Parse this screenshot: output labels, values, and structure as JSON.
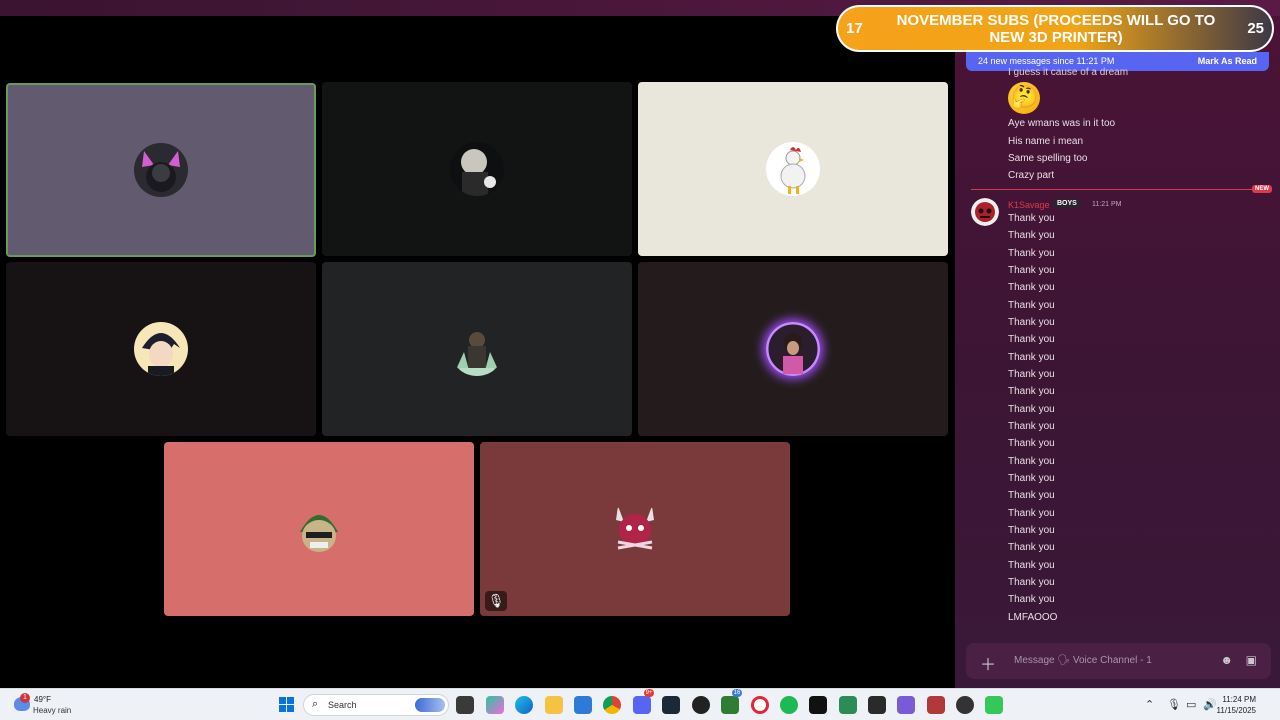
{
  "banner": {
    "left_count": "17",
    "right_count": "25",
    "title": "NOVEMBER SUBS (PROCEEDS WILL GO TO NEW 3D PRINTER)"
  },
  "window": {
    "controls": "—  ▢  ✕"
  },
  "tiles": [
    {
      "bg": "#625a6e",
      "selected": true,
      "avatar": "cat-ears-avatar",
      "muted": false
    },
    {
      "bg": "#121414",
      "selected": false,
      "avatar": "silver-hair-avatar",
      "muted": false
    },
    {
      "bg": "#e9e6dc",
      "selected": false,
      "avatar": "rooster-avatar",
      "muted": false
    },
    {
      "bg": "#171314",
      "selected": false,
      "avatar": "anime-boy-avatar",
      "muted": false
    },
    {
      "bg": "#222324",
      "selected": false,
      "avatar": "dark-knight-avatar",
      "muted": false
    },
    {
      "bg": "#241c1c",
      "selected": false,
      "avatar": "glowing-ring-avatar",
      "muted": false
    },
    {
      "bg": "#d66e6c",
      "selected": false,
      "avatar": "green-mask-avatar",
      "muted": false
    },
    {
      "bg": "#7a3a3b",
      "selected": false,
      "avatar": "red-demon-avatar",
      "muted": true
    }
  ],
  "chat": {
    "new_bar": {
      "text": "24 new messages since 11:21 PM",
      "action": "Mark As Read"
    },
    "prev_messages": [
      "I guess it cause of a dream",
      "Aye wmans was in it too",
      "His name i mean",
      "Same spelling too",
      "Crazy part"
    ],
    "new_tag": "NEW",
    "author": {
      "name": "K1Savage",
      "role": "BOYS",
      "timestamp": "11:21 PM"
    },
    "messages": [
      "Thank you",
      "Thank you",
      "Thank you",
      "Thank you",
      "Thank you",
      "Thank you",
      "Thank you",
      "Thank you",
      "Thank you",
      "Thank you",
      "Thank you",
      "Thank you",
      "Thank you",
      "Thank you",
      "Thank you",
      "Thank you",
      "Thank you",
      "Thank you",
      "Thank you",
      "Thank you",
      "Thank you",
      "Thank you",
      "Thank you",
      "LMFAOOO"
    ],
    "composer_placeholder": "Message 🗣 Voice Channel - 1"
  },
  "taskbar": {
    "weather": {
      "temp": "49°F",
      "condition": "Heavy rain",
      "badge": "1"
    },
    "search": "Search",
    "clock": {
      "time": "11:24 PM",
      "date": "11/15/2025"
    },
    "badges": {
      "discord": "9+",
      "xbox": "16"
    }
  }
}
